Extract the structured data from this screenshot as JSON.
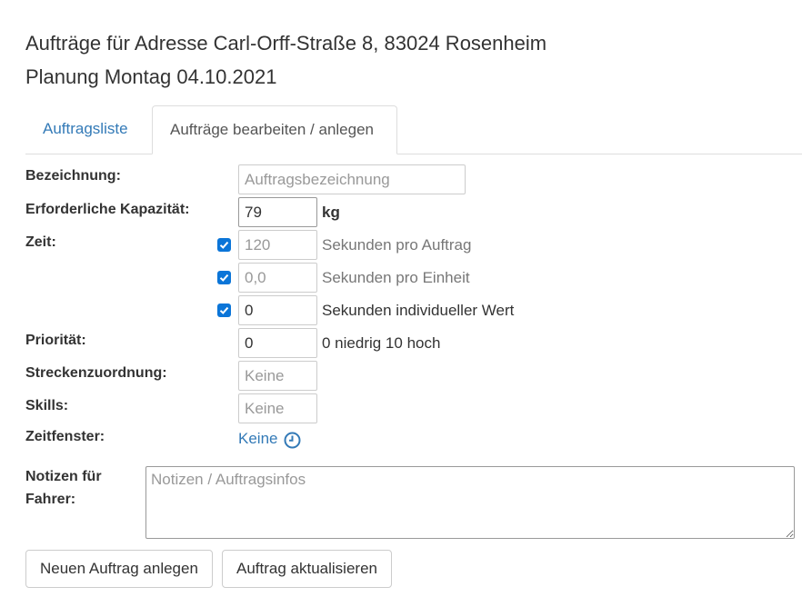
{
  "header": {
    "title": "Aufträge für Adresse Carl-Orff-Straße 8, 83024 Rosenheim",
    "subtitle": "Planung Montag 04.10.2021"
  },
  "tabs": [
    {
      "label": "Auftragsliste",
      "active": false
    },
    {
      "label": "Aufträge bearbeiten / anlegen",
      "active": true
    }
  ],
  "form": {
    "bezeichnung": {
      "label": "Bezeichnung:",
      "placeholder": "Auftragsbezeichnung",
      "value": ""
    },
    "kapazitaet": {
      "label": "Erforderliche Kapazität:",
      "value": "79",
      "unit": "kg"
    },
    "zeit": {
      "label": "Zeit:",
      "rows": [
        {
          "checked": true,
          "placeholder": "120",
          "value": "",
          "unit": "Sekunden pro Auftrag"
        },
        {
          "checked": true,
          "placeholder": "0,0",
          "value": "",
          "unit": "Sekunden pro Einheit"
        },
        {
          "checked": true,
          "placeholder": "",
          "value": "0",
          "unit": "Sekunden individueller Wert"
        }
      ]
    },
    "prioritaet": {
      "label": "Priorität:",
      "value": "0",
      "hint": "0 niedrig 10 hoch"
    },
    "streckenzuordnung": {
      "label": "Streckenzuordnung:",
      "placeholder": "Keine"
    },
    "skills": {
      "label": "Skills:",
      "placeholder": "Keine"
    },
    "zeitfenster": {
      "label": "Zeitfenster:",
      "link": "Keine",
      "icon": "clock-icon"
    },
    "notizen": {
      "label_line1": "Notizen für",
      "label_line2": "Fahrer:",
      "placeholder": "Notizen / Auftragsinfos"
    }
  },
  "buttons": {
    "create": "Neuen Auftrag anlegen",
    "update": "Auftrag aktualisieren"
  },
  "colors": {
    "link": "#337ab7",
    "checkbox": "#0b75d8",
    "placeholder": "#999999"
  }
}
